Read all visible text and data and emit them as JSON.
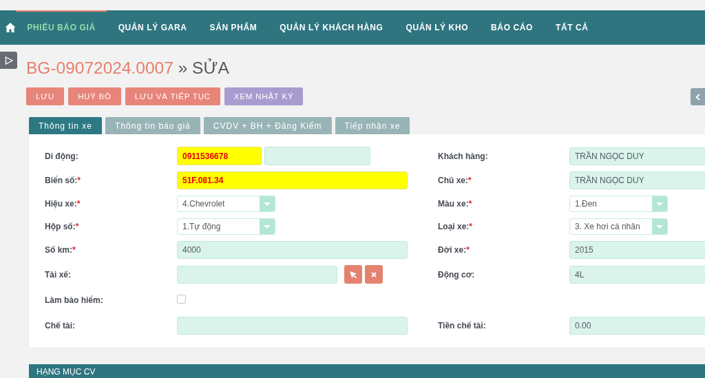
{
  "nav": {
    "items": [
      {
        "label": "PHIẾU BÁO GIÁ",
        "selected": true
      },
      {
        "label": "QUẢN LÝ GARA",
        "selected": false
      },
      {
        "label": "SẢN PHẨM",
        "selected": false
      },
      {
        "label": "QUẢN LÝ KHÁCH HÀNG",
        "selected": false
      },
      {
        "label": "QUẢN LÝ KHO",
        "selected": false
      },
      {
        "label": "BÁO CÁO",
        "selected": false
      },
      {
        "label": "TẤT CẢ",
        "selected": false
      }
    ]
  },
  "title": {
    "code": "BG-09072024.0007",
    "action": "» SỬA"
  },
  "buttons": [
    {
      "label": "LƯU",
      "kind": "primary"
    },
    {
      "label": "HUỶ BỎ",
      "kind": "primary"
    },
    {
      "label": "LƯU VÀ TIẾP TỤC",
      "kind": "primary"
    },
    {
      "label": "XEM NHẬT KÝ",
      "kind": "info"
    }
  ],
  "tabs": [
    {
      "label": "Thông tin xe",
      "selected": true
    },
    {
      "label": "Thông tin báo giá",
      "selected": false
    },
    {
      "label": "CVDV + BH + Đăng Kiểm",
      "selected": false
    },
    {
      "label": "Tiếp nhận xe",
      "selected": false
    }
  ],
  "form": {
    "rows": [
      {
        "left": {
          "label": "Di động:",
          "kind": "pair",
          "inputs": [
            {
              "value": "0911536678",
              "highlighted": true
            },
            {
              "highlighted": false
            }
          ]
        },
        "right": {
          "label": "Khách hàng:",
          "kind": "text",
          "value": "TRẦN NGỌC DUY",
          "highlighted": false
        }
      },
      {
        "left": {
          "label": "Biển số:",
          "required_mark": "*",
          "kind": "text",
          "value": "51F.081.34",
          "highlighted": true
        },
        "right": {
          "label": "Chủ xe:",
          "required_mark": "*",
          "kind": "text",
          "value": "TRẦN NGỌC DUY",
          "highlighted": false
        }
      },
      {
        "left": {
          "label": "Hiệu xe:",
          "required_mark": "*",
          "kind": "select",
          "value": "4.Chevrolet"
        },
        "right": {
          "label": "Màu xe:",
          "required_mark": "*",
          "kind": "select",
          "value": "1.Đen"
        }
      },
      {
        "left": {
          "label": "Hộp số:",
          "required_mark": "*",
          "kind": "select",
          "value": "1.Tự động"
        },
        "right": {
          "label": "Loại xe:",
          "required_mark": "*",
          "kind": "select",
          "value": "3. Xe hơi cá nhân"
        }
      },
      {
        "left": {
          "label": "Số km:",
          "required_mark": "*",
          "kind": "text",
          "value": "4000",
          "highlighted": false
        },
        "right": {
          "label": "Đời xe:",
          "required_mark": "*",
          "kind": "text",
          "value": "2015",
          "highlighted": false
        }
      },
      {
        "left": {
          "label": "Tài xế:",
          "kind": "picker"
        },
        "right": {
          "label": "Động cơ:",
          "kind": "text",
          "value": "4L",
          "highlighted": false
        }
      },
      {
        "left": {
          "label": "Làm bảo hiểm:",
          "kind": "checkbox",
          "checked": false
        }
      },
      {
        "left": {
          "label": "Chế tài:",
          "kind": "text",
          "highlighted": false
        },
        "right": {
          "label": "Tiền chế tài:",
          "kind": "text",
          "value": "0.00",
          "highlighted": false
        }
      }
    ]
  },
  "section": {
    "title": "HẠNG MỤC CV"
  }
}
